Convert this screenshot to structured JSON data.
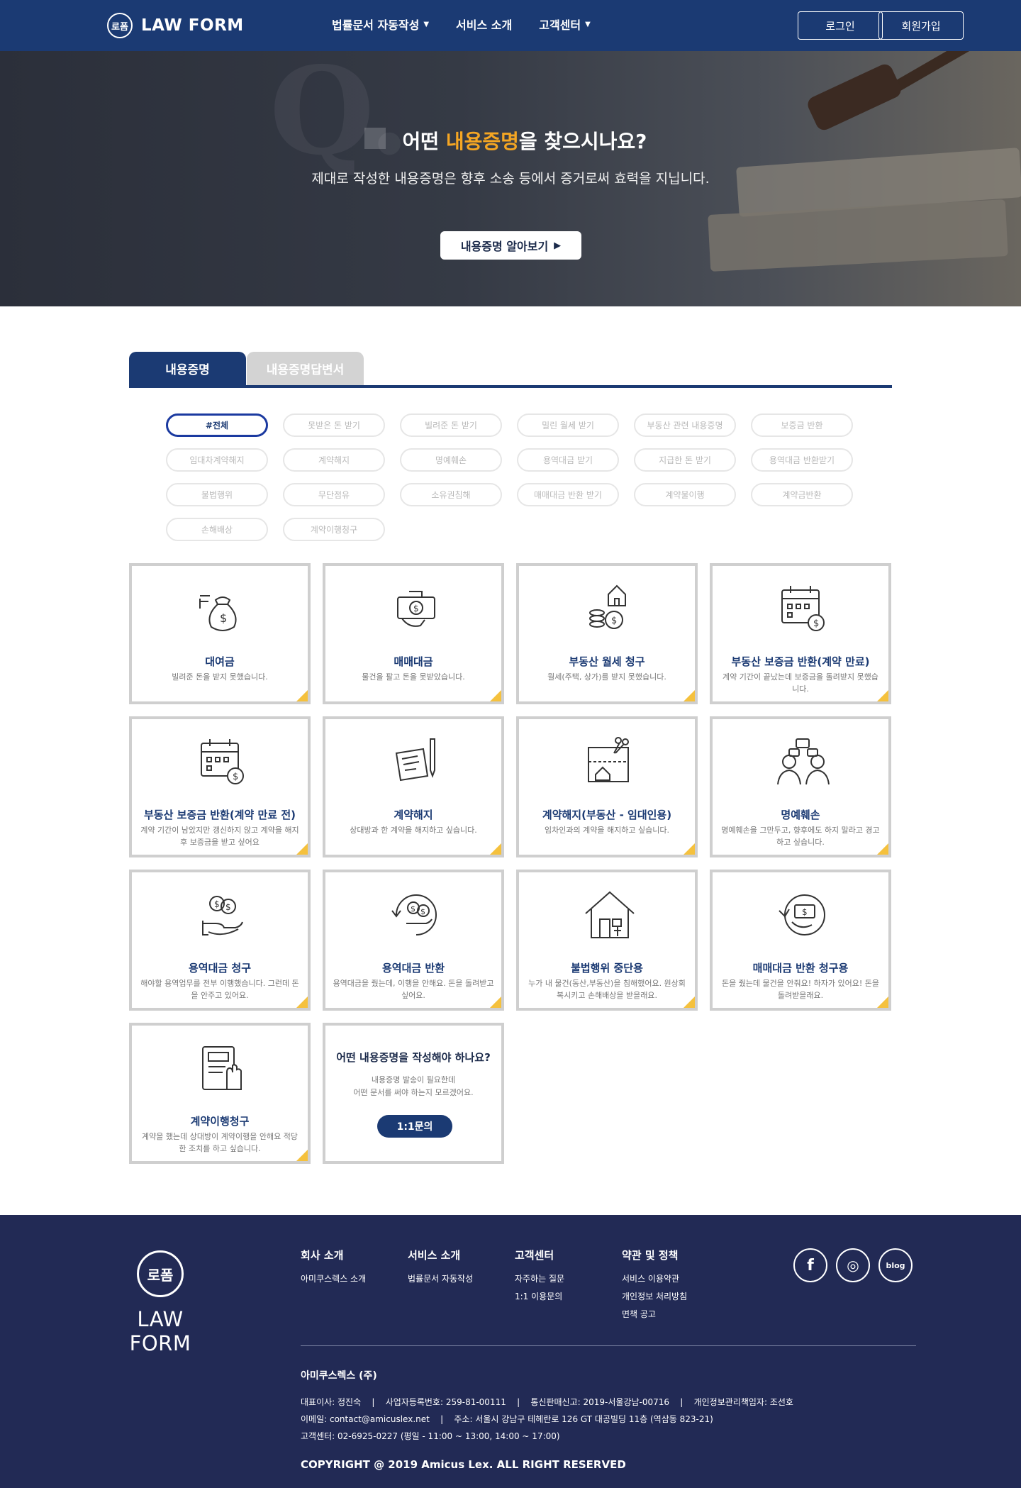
{
  "header": {
    "logo_mark": "로폼",
    "logo_text": "LAW FORM",
    "nav": [
      "법률문서 자동작성",
      "서비스 소개",
      "고객센터"
    ],
    "login": "로그인",
    "join": "회원가입"
  },
  "hero": {
    "q_letter": "Q.",
    "title_pre": "어떤 ",
    "title_accent": "내용증명",
    "title_post": "을 찾으시나요?",
    "subtitle": "제대로 작성한 내용증명은 향후 소송 등에서 증거로써 효력을 지닙니다.",
    "button": "내용증명 알아보기"
  },
  "tabs": [
    "내용증명",
    "내용증명답변서"
  ],
  "filters": [
    "#전체",
    "못받은 돈 받기",
    "빌려준 돈 받기",
    "밀린 월세 받기",
    "부동산 관련 내용증명",
    "보증금 반환",
    "임대차계약해지",
    "계약해지",
    "명예훼손",
    "용역대금 받기",
    "지급한 돈 받기",
    "용역대금 반환받기",
    "불법행위",
    "무단점유",
    "소유권침해",
    "매매대금 반환 받기",
    "계약불이행",
    "계약금반환",
    "손해배상",
    "계약이행청구"
  ],
  "cards": [
    {
      "title": "대여금",
      "desc": "빌려준 돈을 받지 못했습니다.",
      "icon": "money-bag-icon"
    },
    {
      "title": "매매대금",
      "desc": "물건을 팔고 돈을 못받았습니다.",
      "icon": "cash-hand-icon"
    },
    {
      "title": "부동산 월세 청구",
      "desc": "월세(주택, 상가)를 받지 못했습니다.",
      "icon": "house-coins-icon"
    },
    {
      "title": "부동산 보증금 반환(계약 만료)",
      "desc": "계약 기간이 끝났는데 보증금을 돌려받지 못했습니다.",
      "icon": "calendar-dollar-icon"
    },
    {
      "title": "부동산 보증금 반환(계약 만료 전)",
      "desc": "계약 기간이 남았지만 갱신하지 않고 계약을 해지 후 보증금을 받고 싶어요",
      "icon": "calendar-dollar-icon"
    },
    {
      "title": "계약해지",
      "desc": "상대방과 한 계약을 해지하고 싶습니다.",
      "icon": "contract-pen-icon"
    },
    {
      "title": "계약해지(부동산 - 임대인용)",
      "desc": "임차인과의 계약을 해지하고 싶습니다.",
      "icon": "blueprint-cut-icon"
    },
    {
      "title": "명예훼손",
      "desc": "명예훼손을 그만두고, 향후에도 하지 말라고 경고하고 싶습니다.",
      "icon": "people-talk-icon"
    },
    {
      "title": "용역대금 청구",
      "desc": "해야할 용역업무를 전부 이행했습니다. 그런데 돈을 안주고 있어요.",
      "icon": "hand-coins-icon"
    },
    {
      "title": "용역대금 반환",
      "desc": "용역대금을 줬는데, 이행을 안해요. 돈을 돌려받고 싶어요.",
      "icon": "refund-coins-icon"
    },
    {
      "title": "불법행위 중단용",
      "desc": "누가 내 물건(동산,부동산)을 침해했어요. 원상회복시키고 손해배상을 받을래요.",
      "icon": "house-gavel-icon"
    },
    {
      "title": "매매대금 반환 청구용",
      "desc": "돈을 줬는데 물건을 안줘요! 하자가 있어요! 돈을 돌려받을래요.",
      "icon": "refund-cash-icon"
    },
    {
      "title": "계약이행청구",
      "desc": "계약을 했는데 상대방이 계약이행을 안해요 적당한 조치를 하고 싶습니다.",
      "icon": "contract-hand-icon"
    }
  ],
  "inquiry": {
    "title": "어떤 내용증명을 작성해야 하나요?",
    "desc_line1": "내용증명 발송이 필요한데",
    "desc_line2": "어떤 문서를 써야 하는지 모르겠어요.",
    "button": "1:1문의"
  },
  "footer": {
    "logo_mark": "로폼",
    "logo_text": "LAW FORM",
    "columns": [
      {
        "heading": "회사 소개",
        "links": [
          "아미쿠스렉스 소개"
        ]
      },
      {
        "heading": "서비스 소개",
        "links": [
          "법률문서 자동작성"
        ]
      },
      {
        "heading": "고객센터",
        "links": [
          "자주하는 질문",
          "1:1 이용문의"
        ]
      },
      {
        "heading": "약관 및 정책",
        "links": [
          "서비스 이용약관",
          "개인정보 처리방침",
          "면책 공고"
        ]
      }
    ],
    "social": [
      {
        "label": "f",
        "icon": "facebook-icon"
      },
      {
        "label": "◎",
        "icon": "instagram-icon"
      },
      {
        "label": "blog",
        "icon": "blog-icon"
      }
    ],
    "company": "아미쿠스렉스 (주)",
    "info_line1": "대표이사: 정진숙    |    사업자등록번호: 259-81-00111    |    통신판매신고: 2019-서울강남-00716    |    개인정보관리책임자: 조선호",
    "info_line2": "이메일: contact@amicuslex.net    |    주소: 서울시 강남구 테헤란로 126 GT 대공빌딩 11층 (역삼동 823-21)",
    "info_line3": "고객센터: 02-6925-0227 (평일 - 11:00 ~ 13:00, 14:00 ~ 17:00)",
    "copyright": "COPYRIGHT @ 2019 Amicus Lex. ALL RIGHT RESERVED"
  }
}
